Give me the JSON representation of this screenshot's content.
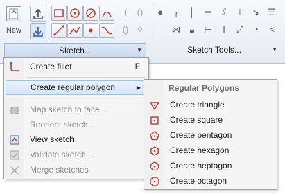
{
  "ribbon": {
    "new_label": "New",
    "groups": {
      "sketch_label": "Sketch...",
      "tools_label": "Sketch Tools..."
    }
  },
  "menu": {
    "items": [
      {
        "label": "Create fillet",
        "shortcut": "F",
        "icon": "fillet-icon",
        "disabled": false
      },
      {
        "label": "Create regular polygon",
        "icon": "none",
        "disabled": false,
        "submenu": true
      },
      {
        "label": "Map sketch to face...",
        "icon": "map-sketch-icon",
        "disabled": true
      },
      {
        "label": "Reorient sketch...",
        "icon": "none",
        "disabled": true
      },
      {
        "label": "View sketch",
        "icon": "view-sketch-icon",
        "disabled": false
      },
      {
        "label": "Validate sketch...",
        "icon": "validate-sketch-icon",
        "disabled": true
      },
      {
        "label": "Merge sketches",
        "icon": "merge-sketches-icon",
        "disabled": true
      }
    ]
  },
  "submenu": {
    "header": "Regular Polygons",
    "items": [
      {
        "label": "Create triangle",
        "icon": "triangle-icon"
      },
      {
        "label": "Create square",
        "icon": "square-icon"
      },
      {
        "label": "Create pentagon",
        "icon": "pentagon-icon"
      },
      {
        "label": "Create hexagon",
        "icon": "hexagon-icon"
      },
      {
        "label": "Create heptagon",
        "icon": "heptagon-icon"
      },
      {
        "label": "Create octagon",
        "icon": "octagon-icon"
      }
    ]
  },
  "colors": {
    "accent_red": "#c0392b",
    "highlight": "#d5e6f8",
    "ribbon_bg": "#e6ebf3"
  }
}
